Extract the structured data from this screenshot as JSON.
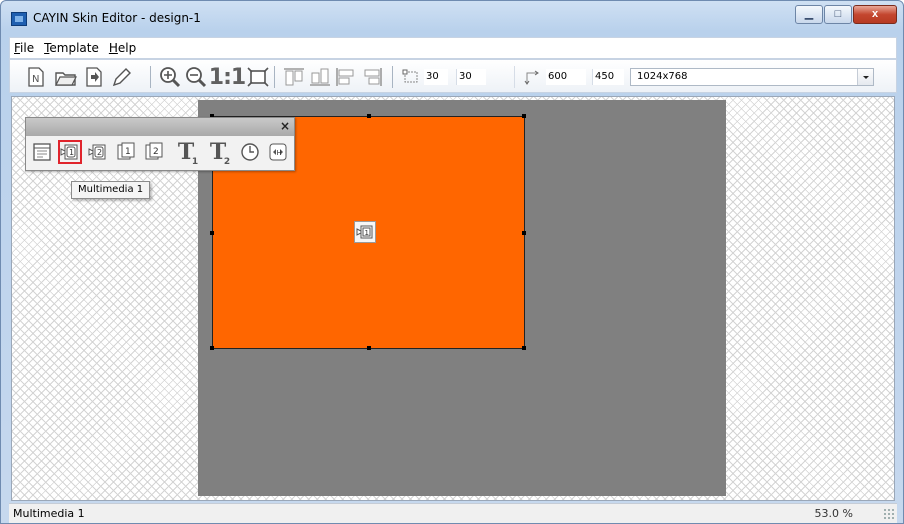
{
  "window": {
    "title": "CAYIN Skin Editor - design-1",
    "minimize_label": "▁",
    "maximize_label": "□",
    "close_label": "x"
  },
  "menu": {
    "items": [
      {
        "accel": "F",
        "rest": "ile"
      },
      {
        "accel": "T",
        "rest": "emplate"
      },
      {
        "accel": "H",
        "rest": "elp"
      }
    ]
  },
  "toolbar": {
    "icons": [
      "new-icon",
      "open-icon",
      "save-icon",
      "edit-icon",
      "zoom-in-icon",
      "zoom-out-icon",
      "actual-size-icon",
      "fit-icon",
      "align-top-icon",
      "align-bottom-icon",
      "align-left-icon",
      "align-right-icon",
      "position-icon",
      "size-icon"
    ],
    "actual_size_label": "1:1",
    "position_x": "30",
    "position_y": "30",
    "width": "600",
    "height": "450",
    "resolution": "1024x768"
  },
  "palette": {
    "close_label": "×",
    "tools": [
      "background-icon",
      "multimedia-1-icon",
      "multimedia-2-icon",
      "image-1-icon",
      "image-2-icon",
      "text-1-icon",
      "text-2-icon",
      "clock-icon",
      "web-icon"
    ],
    "text1_main": "T",
    "text1_sub": "1",
    "text2_main": "T",
    "text2_sub": "2",
    "active_tool": "multimedia-1-icon"
  },
  "tooltip": "Multimedia 1",
  "canvas": {
    "background_color": "#808080",
    "region_color": "#ff6600"
  },
  "status": {
    "text": "Multimedia 1",
    "zoom": "53.0 %"
  }
}
